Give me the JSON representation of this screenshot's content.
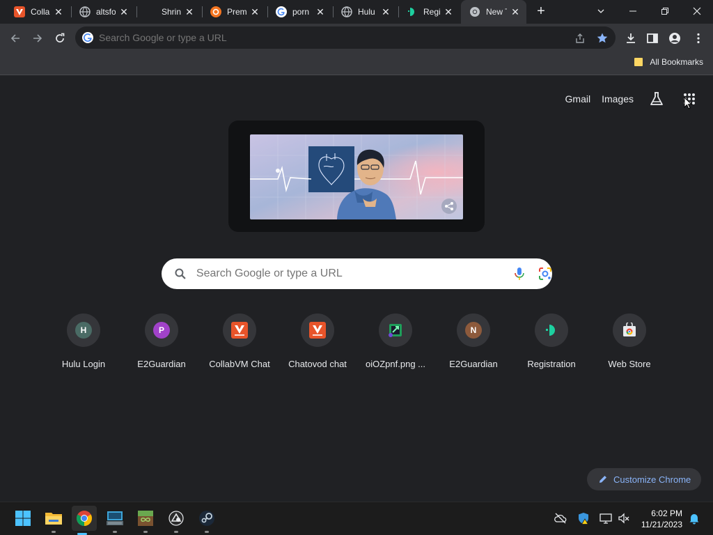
{
  "tabs": [
    {
      "title": "CollabVM",
      "favicon": "collabvm-icon",
      "color": "#e8542a"
    },
    {
      "title": "altsfor",
      "favicon": "globe-icon",
      "color": "#9aa0a6"
    },
    {
      "title": "Shrink",
      "favicon": "blank-icon",
      "color": "#202124"
    },
    {
      "title": "Premium",
      "favicon": "crunchyroll-icon",
      "color": "#f47521"
    },
    {
      "title": "porn",
      "favicon": "google-icon",
      "color": "#ffffff"
    },
    {
      "title": "Hulu",
      "favicon": "globe-icon",
      "color": "#9aa0a6"
    },
    {
      "title": "Registration",
      "favicon": "registration-icon",
      "color": "#1dcf9f"
    },
    {
      "title": "New Tab",
      "favicon": "chrome-icon",
      "color": "#9aa0a6"
    }
  ],
  "omnibox": {
    "placeholder": "Search Google or type a URL"
  },
  "bookmarks": {
    "all_label": "All Bookmarks"
  },
  "ntp": {
    "gmail": "Gmail",
    "images": "Images",
    "search_placeholder": "Search Google or type a URL",
    "customize": "Customize Chrome"
  },
  "shortcuts": [
    {
      "label": "Hulu Login",
      "icon": "letter-H",
      "letter": "H",
      "color": "#4a6b65"
    },
    {
      "label": "E2Guardian",
      "icon": "letter-P",
      "letter": "P",
      "color": "#a142c9"
    },
    {
      "label": "CollabVM Chat",
      "icon": "collabvm-icon",
      "letter": "",
      "color": "#e8542a"
    },
    {
      "label": "Chatovod chat",
      "icon": "collabvm-icon",
      "letter": "",
      "color": "#e8542a"
    },
    {
      "label": "oiOZpnf.png ...",
      "icon": "image-icon",
      "letter": "",
      "color": "#1e9e5a"
    },
    {
      "label": "E2Guardian",
      "icon": "letter-N",
      "letter": "N",
      "color": "#8d5a3c"
    },
    {
      "label": "Registration",
      "icon": "registration-icon",
      "letter": "",
      "color": "#1dcf9f"
    },
    {
      "label": "Web Store",
      "icon": "webstore-icon",
      "letter": "",
      "color": "#e8eaed"
    }
  ],
  "taskbar": {
    "time": "6:02 PM",
    "date": "11/21/2023"
  }
}
